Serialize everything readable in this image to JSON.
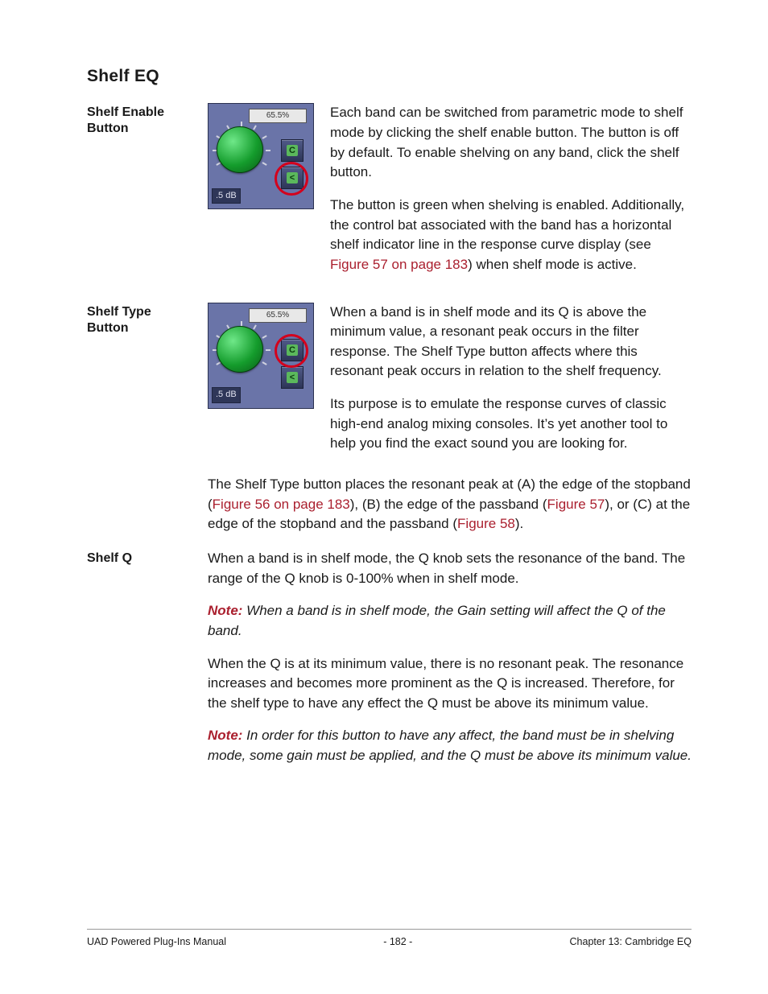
{
  "heading": "Shelf EQ",
  "sec1": {
    "label": "Shelf Enable Button",
    "thumb": {
      "meter": "65.5%",
      "db": ".5 dB",
      "c": "C",
      "s": "<"
    },
    "p1": "Each band can be switched from parametric mode to shelf mode by clicking the shelf enable button. The button is off by default. To enable shelving on any band, click the shelf button.",
    "p2a": "The button is green when shelving is enabled. Additionally, the control bat associated with the band has a horizontal shelf indicator line in the response curve display (see ",
    "p2link": "Figure 57 on page 183",
    "p2b": ") when shelf mode is active."
  },
  "sec2": {
    "label": "Shelf Type Button",
    "thumb": {
      "meter": "65.5%",
      "db": ".5 dB",
      "c": "C",
      "s": "<"
    },
    "p1": "When a band is in shelf mode and its Q is above the minimum value, a resonant peak occurs in the filter response. The Shelf Type button affects where this resonant peak occurs in relation to the shelf frequency.",
    "p2": "Its purpose is to emulate the response curves of classic high-end analog mixing consoles. It’s yet another tool to help you find the exact sound you are looking for.",
    "p3a": "The Shelf Type button places the resonant peak at (A) the edge of the stopband (",
    "p3l1": "Figure 56 on page 183",
    "p3b": "), (B) the edge of the passband (",
    "p3l2": "Figure 57",
    "p3c": "), or (C) at the edge of the stopband and the passband (",
    "p3l3": "Figure 58",
    "p3d": ")."
  },
  "sec3": {
    "label": "Shelf Q",
    "p1": "When a band is in shelf mode, the Q knob sets the resonance of the band. The range of the Q knob is 0-100% when in shelf mode.",
    "note1label": "Note:",
    "note1": " When a band is in shelf mode, the Gain setting will affect the Q of the band.",
    "p2": "When the Q is at its minimum value, there is no resonant peak. The resonance increases and becomes more prominent as the Q is increased. Therefore, for the shelf type to have any effect the Q must be above its minimum value.",
    "note2label": "Note:",
    "note2": " In order for this button to have any affect, the band must be in shelving mode, some gain must be applied, and the Q must be above its minimum value."
  },
  "footer": {
    "left": "UAD Powered Plug-Ins Manual",
    "center": "- 182 -",
    "right": "Chapter 13: Cambridge EQ"
  }
}
